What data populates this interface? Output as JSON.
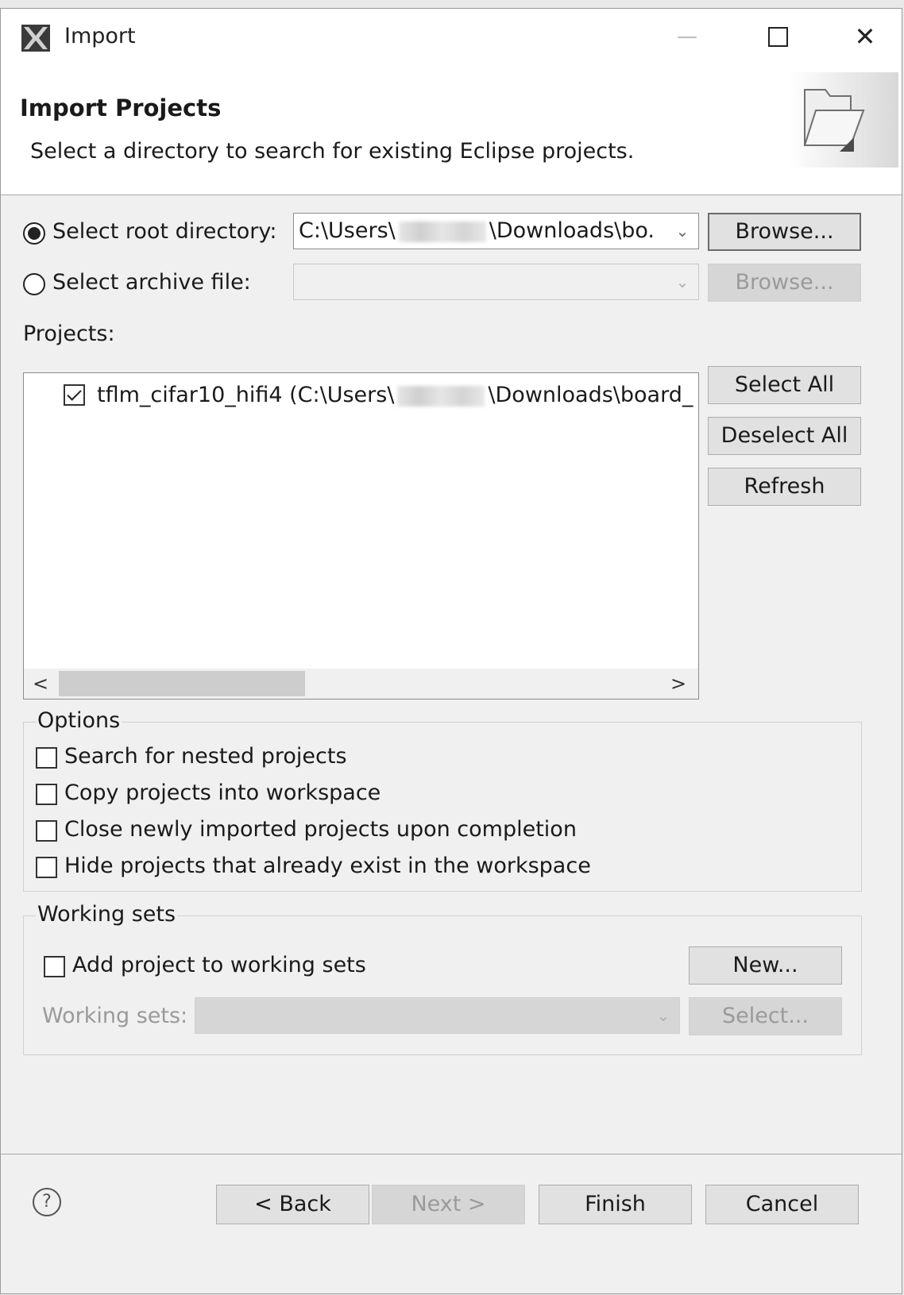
{
  "window": {
    "title": "Import",
    "minimize_glyph": "—",
    "close_glyph": "✕"
  },
  "header": {
    "title": "Import Projects",
    "description": "Select a directory to search for existing Eclipse projects."
  },
  "source": {
    "root_label": "Select root directory:",
    "root_selected": true,
    "root_value_prefix": "C:\\Users\\",
    "root_value_suffix": "\\Downloads\\bo.",
    "root_browse": "Browse...",
    "archive_label": "Select archive file:",
    "archive_selected": false,
    "archive_value": "",
    "archive_browse": "Browse..."
  },
  "projects": {
    "label": "Projects:",
    "items": [
      {
        "name_prefix": "tflm_cifar10_hifi4 (C:\\Users\\",
        "name_suffix": "\\Downloads\\board_",
        "checked": true
      }
    ],
    "select_all": "Select All",
    "deselect_all": "Deselect All",
    "refresh": "Refresh",
    "scroll_left": "<",
    "scroll_right": ">"
  },
  "options": {
    "title": "Options",
    "items": [
      {
        "label": "Search for nested projects",
        "checked": false
      },
      {
        "label": "Copy projects into workspace",
        "checked": false
      },
      {
        "label": "Close newly imported projects upon completion",
        "checked": false
      },
      {
        "label": "Hide projects that already exist in the workspace",
        "checked": false
      }
    ]
  },
  "working_sets": {
    "title": "Working sets",
    "add_label": "Add project to working sets",
    "add_checked": false,
    "new_button": "New...",
    "sets_label": "Working sets:",
    "sets_value": "",
    "select_button": "Select..."
  },
  "footer": {
    "help_glyph": "?",
    "back": "< Back",
    "next": "Next >",
    "finish": "Finish",
    "cancel": "Cancel"
  }
}
